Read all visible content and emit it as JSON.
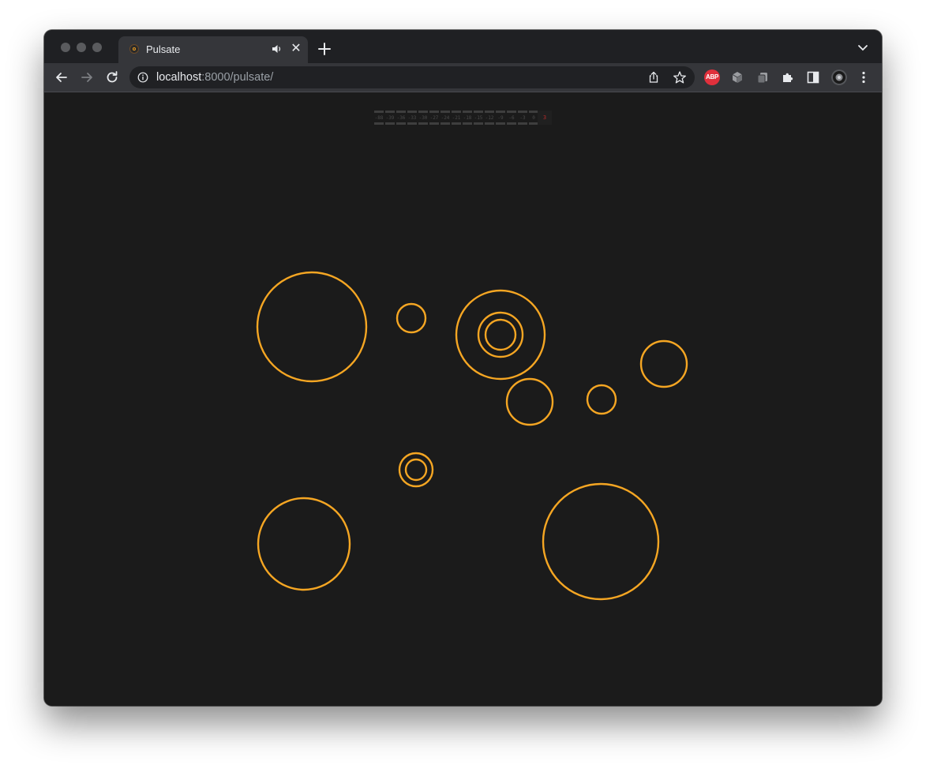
{
  "browser": {
    "tab": {
      "title": "Pulsate",
      "audio_icon": "speaker-icon",
      "close_label": "✕"
    },
    "new_tab_label": "+",
    "url_host": "localhost",
    "url_rest": ":8000/pulsate/",
    "extensions": {
      "abp_label": "ABP"
    },
    "colors": {
      "frame": "#1f2023",
      "toolbar": "#35363a",
      "omnibox": "#202124"
    }
  },
  "meter": {
    "labels": [
      "-88",
      "-39",
      "-36",
      "-33",
      "-30",
      "-27",
      "-24",
      "-21",
      "-18",
      "-15",
      "-12",
      "-9",
      "-6",
      "-3",
      "0"
    ],
    "clip_label": "3",
    "colors": {
      "segment": "#3e3e3e",
      "clip": "#b12a2a"
    }
  },
  "visual": {
    "ring_color": "#f5a623",
    "background": "#1b1b1b"
  }
}
